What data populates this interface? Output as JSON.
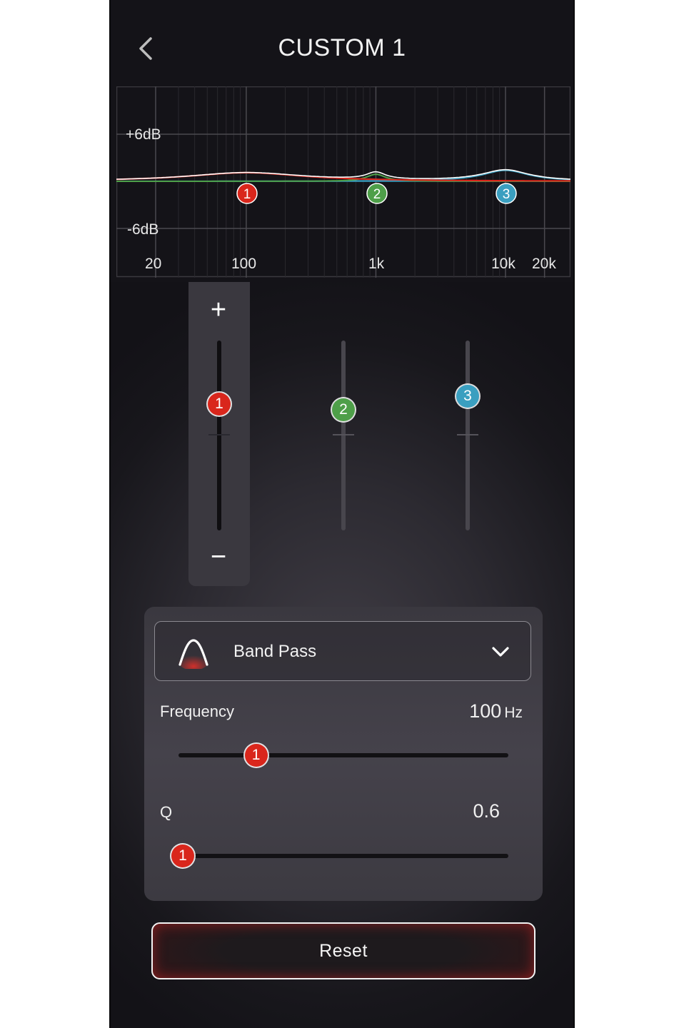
{
  "header": {
    "title": "CUSTOM 1"
  },
  "graph": {
    "y_labels": [
      "+6dB",
      "-6dB"
    ],
    "x_labels": [
      "20",
      "100",
      "1k",
      "10k",
      "20k"
    ],
    "curve_colors": {
      "combined": "#ffffff",
      "band1": "#d9261c",
      "band2": "#4e9f49",
      "band3": "#3a9fc0"
    }
  },
  "bands": [
    {
      "label": "1",
      "color": "#d9261c",
      "frequency_hz": 100,
      "gain_db": 1.1,
      "selected": true
    },
    {
      "label": "2",
      "color": "#4e9f49",
      "frequency_hz": 1000,
      "gain_db": 0.9,
      "selected": false
    },
    {
      "label": "3",
      "color": "#3a9fc0",
      "frequency_hz": 10000,
      "gain_db": 1.4,
      "selected": false
    }
  ],
  "gain_controls": {
    "plus": "+",
    "minus": "−"
  },
  "filter": {
    "type_label": "Band Pass",
    "frequency": {
      "label": "Frequency",
      "value": "100",
      "unit": "Hz",
      "fraction": 0.235
    },
    "q": {
      "label": "Q",
      "value": "0.6",
      "fraction": 0.0
    },
    "active_band_label": "1"
  },
  "reset_label": "Reset"
}
